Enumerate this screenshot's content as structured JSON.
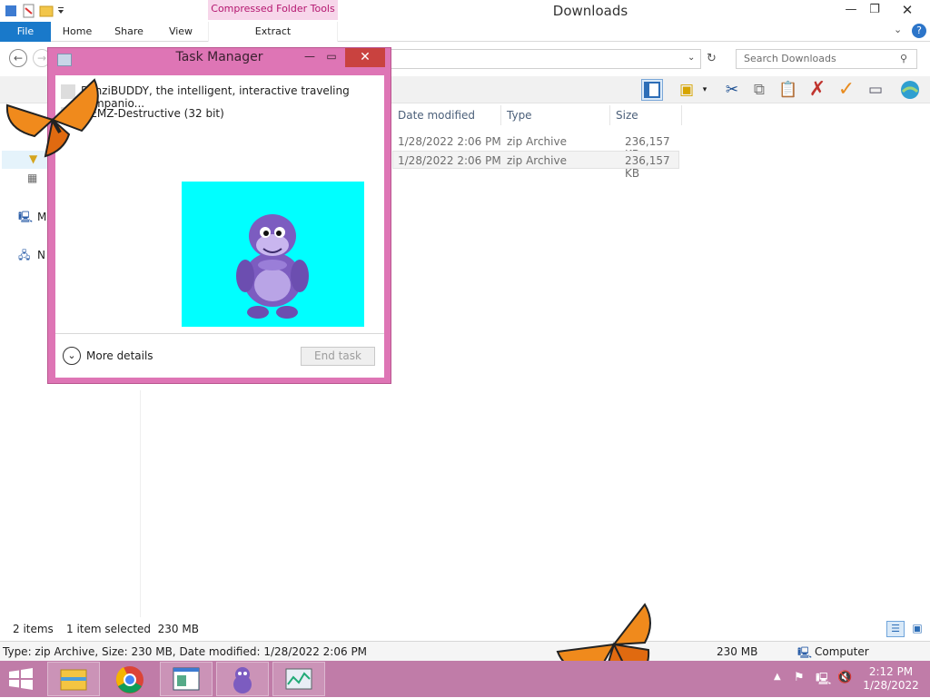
{
  "explorer": {
    "window_title": "Downloads",
    "context_tab": "Compressed Folder Tools",
    "tabs": {
      "file": "File",
      "home": "Home",
      "share": "Share",
      "view": "View",
      "extract": "Extract"
    },
    "search_placeholder": "Search Downloads",
    "columns": {
      "date": "Date modified",
      "type": "Type",
      "size": "Size"
    },
    "files": [
      {
        "date": "1/28/2022 2:06 PM",
        "type": "zip Archive",
        "size": "236,157 KB"
      },
      {
        "date": "1/28/2022 2:06 PM",
        "type": "zip Archive",
        "size": "236,157 KB"
      }
    ],
    "nav_labels": {
      "computer": "M",
      "network": "N"
    },
    "status": {
      "items": "2 items",
      "selected": "1 item selected  230 MB"
    },
    "details": {
      "info": "Type: zip Archive, Size: 230 MB, Date modified: 1/28/2022 2:06 PM",
      "size": "230 MB",
      "location": "Computer"
    }
  },
  "taskmanager": {
    "title": "Task Manager",
    "processes": [
      {
        "name": "BonziBUDDY, the intelligent, interactive traveling companio..."
      },
      {
        "name": "MEMZ-Destructive (32 bit)"
      }
    ],
    "more_details": "More details",
    "end_task": "End task"
  },
  "taskbar": {
    "time": "2:12 PM",
    "date": "1/28/2022"
  },
  "icons": {
    "start": "windows-start-icon",
    "explorer": "file-explorer-icon",
    "chrome": "chrome-icon",
    "bonzi": "bonzi-buddy-icon"
  },
  "colors": {
    "taskbar": "#c07ca8",
    "taskmanager_frame": "#de75b5",
    "file_tab": "#1979ca",
    "bonzi_bg": "#00ffff",
    "close": "#c9423f"
  }
}
